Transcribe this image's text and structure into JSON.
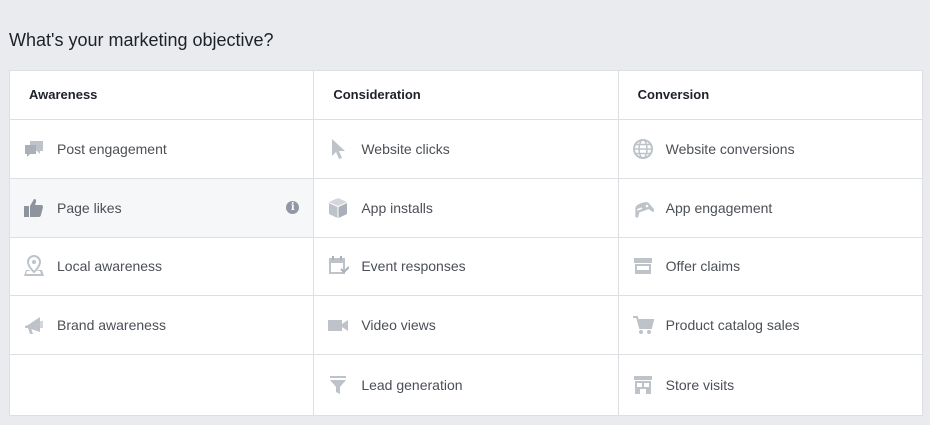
{
  "title": "What's your marketing objective?",
  "columns": [
    {
      "header": "Awareness",
      "items": [
        {
          "label": "Post engagement",
          "icon": "speech-bubbles-icon"
        },
        {
          "label": "Page likes",
          "icon": "thumbs-up-icon"
        },
        {
          "label": "Local awareness",
          "icon": "map-pin-icon"
        },
        {
          "label": "Brand awareness",
          "icon": "megaphone-icon"
        }
      ]
    },
    {
      "header": "Consideration",
      "items": [
        {
          "label": "Website clicks",
          "icon": "cursor-icon"
        },
        {
          "label": "App installs",
          "icon": "cube-icon"
        },
        {
          "label": "Event responses",
          "icon": "calendar-icon"
        },
        {
          "label": "Video views",
          "icon": "video-camera-icon"
        },
        {
          "label": "Lead generation",
          "icon": "funnel-icon"
        }
      ]
    },
    {
      "header": "Conversion",
      "items": [
        {
          "label": "Website conversions",
          "icon": "globe-icon"
        },
        {
          "label": "App engagement",
          "icon": "gamepad-icon"
        },
        {
          "label": "Offer claims",
          "icon": "storefront-icon"
        },
        {
          "label": "Product catalog sales",
          "icon": "shopping-cart-icon"
        },
        {
          "label": "Store visits",
          "icon": "store-icon"
        }
      ]
    }
  ],
  "selected": "Page likes",
  "info_glyph": "i",
  "colors": {
    "background": "#e9ebee",
    "border": "#dddfe2",
    "icon": "#bec3c9",
    "icon_selected": "#8d949e",
    "selected_row": "#f6f7f9"
  }
}
